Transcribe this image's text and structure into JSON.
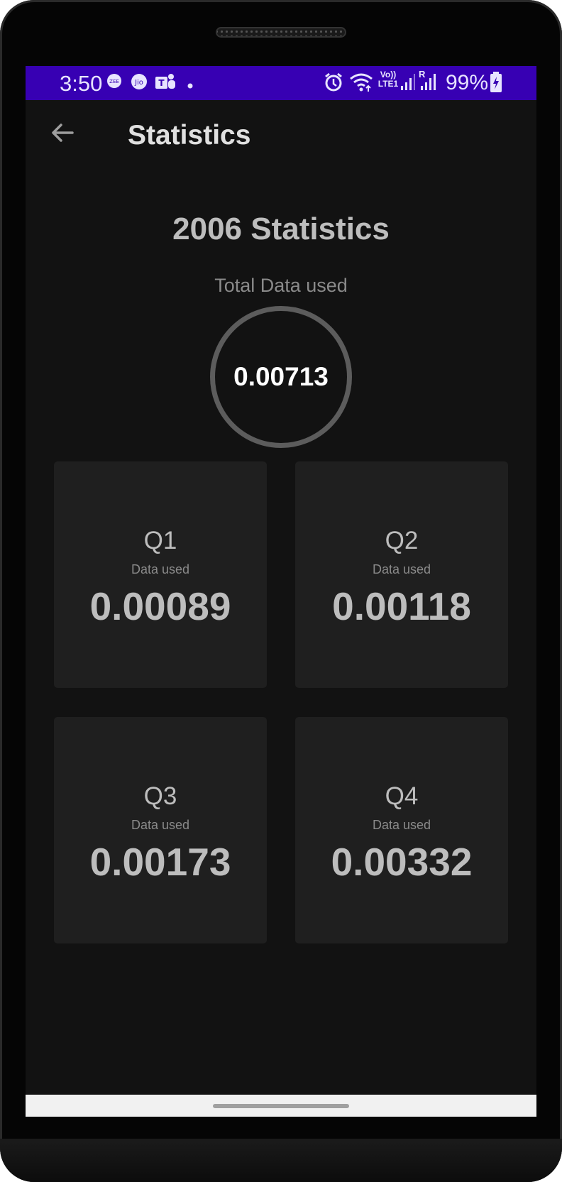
{
  "status_bar": {
    "time": "3:50",
    "battery": "99%",
    "network_label": "Vo)) LTE1",
    "roaming": "R",
    "icons": [
      "zee5-icon",
      "jio-icon",
      "teams-icon",
      "dot-icon",
      "alarm-icon",
      "wifi-icon",
      "signal-icon",
      "signal-roaming-icon",
      "battery-charging-icon"
    ]
  },
  "app_bar": {
    "title": "Statistics",
    "back_icon": "arrow-back-icon"
  },
  "main": {
    "year_title": "2006 Statistics",
    "total_label": "Total Data used",
    "total_value": "0.00713",
    "quarters": [
      {
        "label": "Q1",
        "sub": "Data used",
        "value": "0.00089"
      },
      {
        "label": "Q2",
        "sub": "Data used",
        "value": "0.00118"
      },
      {
        "label": "Q3",
        "sub": "Data used",
        "value": "0.00173"
      },
      {
        "label": "Q4",
        "sub": "Data used",
        "value": "0.00332"
      }
    ]
  },
  "colors": {
    "status_bar": "#3700b3",
    "background": "#121212",
    "card": "#1f1f1f",
    "ring": "#5c5c5c"
  }
}
